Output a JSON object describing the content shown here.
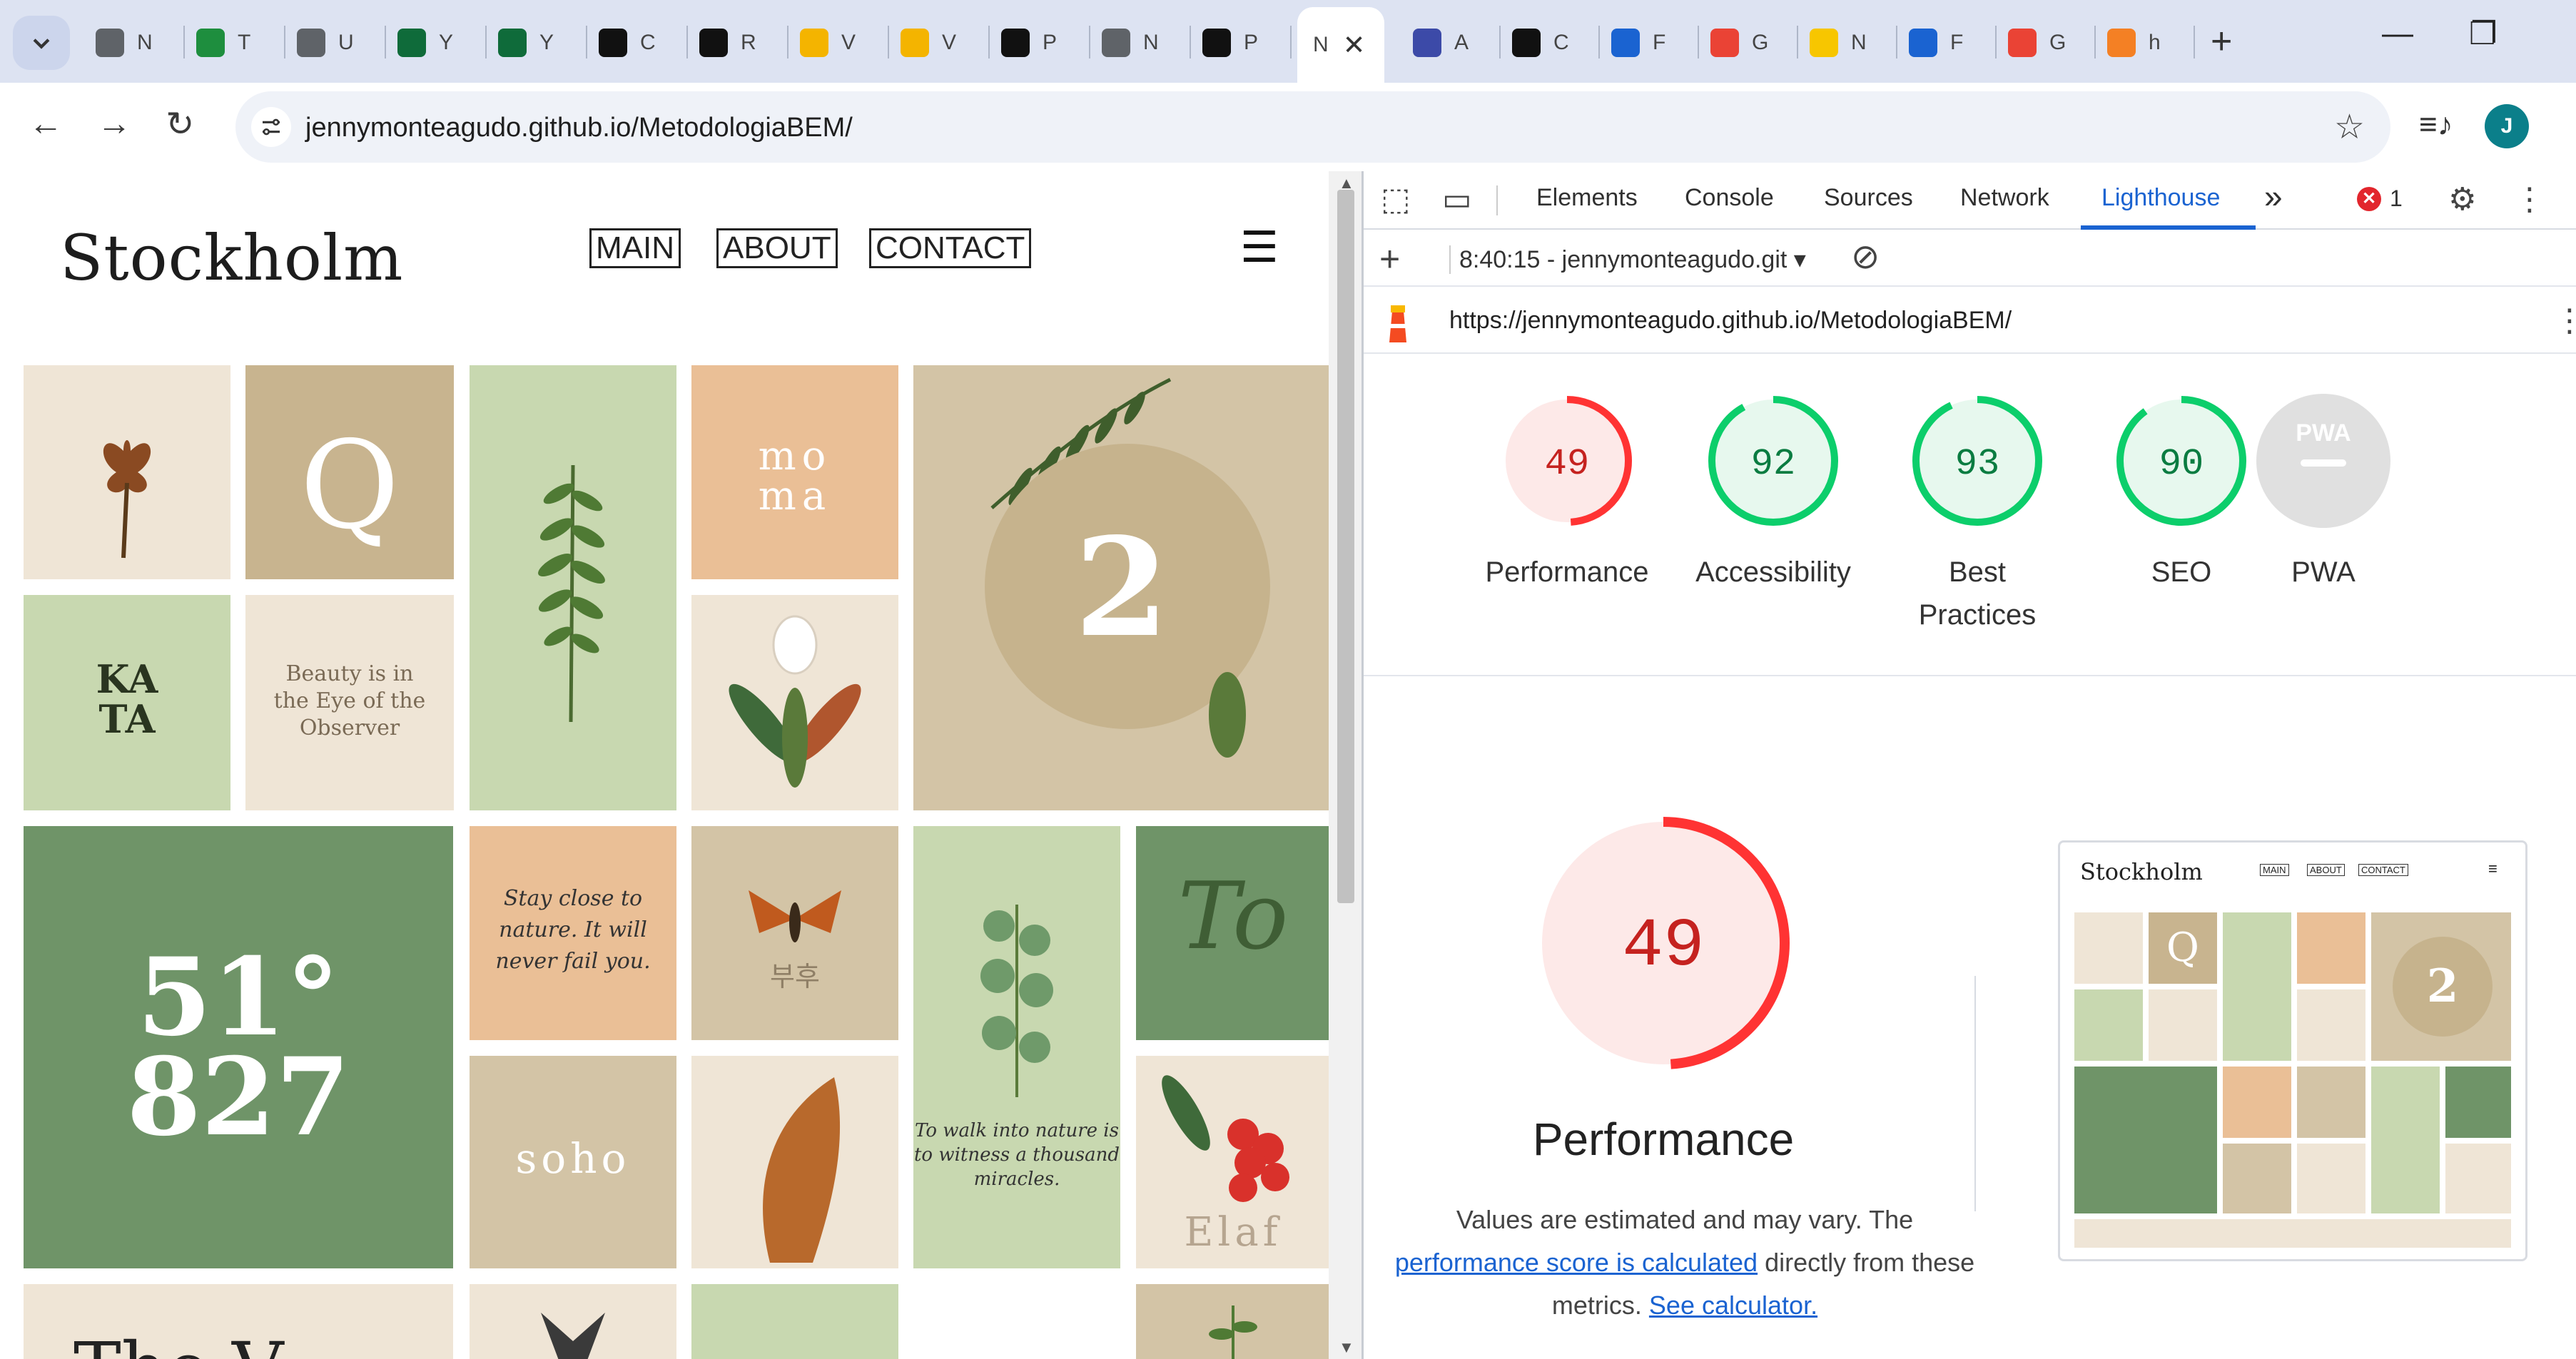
{
  "browser": {
    "tabs": [
      {
        "letter": "N",
        "icon": "globe-icon",
        "color": "#5f6368"
      },
      {
        "letter": "T",
        "icon": "classroom-icon",
        "color": "#1e8e3e"
      },
      {
        "letter": "U",
        "icon": "at-sign-icon",
        "color": "#5f6368"
      },
      {
        "letter": "Y",
        "icon": "flask-icon",
        "color": "#0f6b3a"
      },
      {
        "letter": "Y",
        "icon": "flask-icon",
        "color": "#0f6b3a"
      },
      {
        "letter": "C",
        "icon": "w-icon",
        "color": "#111111"
      },
      {
        "letter": "R",
        "icon": "puzzle-icon",
        "color": "#111111"
      },
      {
        "letter": "V",
        "icon": "drive-icon",
        "color": "#f4b400"
      },
      {
        "letter": "V",
        "icon": "drive-icon",
        "color": "#f4b400"
      },
      {
        "letter": "P",
        "icon": "github-icon",
        "color": "#111111"
      },
      {
        "letter": "N",
        "icon": "globe-icon",
        "color": "#5f6368"
      },
      {
        "letter": "P",
        "icon": "github-icon",
        "color": "#111111"
      }
    ],
    "active_tab": {
      "letter": "N"
    },
    "tabs_right": [
      {
        "letter": "A",
        "icon": "compass-icon",
        "color": "#3c4aa8"
      },
      {
        "letter": "C",
        "icon": "diamond-icon",
        "color": "#111111"
      },
      {
        "letter": "F",
        "icon": "flag-icon",
        "color": "#1a63d1"
      },
      {
        "letter": "G",
        "icon": "google-icon",
        "color": "#ea4335"
      },
      {
        "letter": "N",
        "icon": "mail-icon",
        "color": "#f7c600"
      },
      {
        "letter": "F",
        "icon": "flag-icon",
        "color": "#1a63d1"
      },
      {
        "letter": "G",
        "icon": "google-icon",
        "color": "#ea4335"
      },
      {
        "letter": "h",
        "icon": "stack-icon",
        "color": "#f48024"
      }
    ],
    "url": "jennymonteagudo.github.io/MetodologiaBEM/",
    "profile_initial": "J",
    "newtab_label": "+",
    "window": {
      "minimize": "—",
      "restore": "❐"
    }
  },
  "site": {
    "logo": "Stockholm",
    "nav": [
      "MAIN",
      "ABOUT",
      "CONTACT"
    ],
    "menu_icon": "☰",
    "tiles": {
      "q": "Q",
      "moma": "mo\nma",
      "two": "2",
      "kata": "KA\nTA",
      "beauty": "Beauty is in\nthe Eye of the\nObserver",
      "number": "51°\n827",
      "stay": "Stay close to\nnature. It will\nnever fail you.",
      "moth_text": "부후",
      "walk": "To walk into nature is\nto witness a thousand\nmiracles.",
      "to": "To",
      "soho": "soho",
      "elaf": "Elaf",
      "bottom": "The V"
    }
  },
  "devtools": {
    "tabs": [
      "Elements",
      "Console",
      "Sources",
      "Network",
      "Lighthouse"
    ],
    "active_tab": "Lighthouse",
    "more": "»",
    "error_count": "1",
    "report_time": "8:40:15 - jennymonteagudo.git",
    "report_url": "https://jennymonteagudo.github.io/MetodologiaBEM/",
    "scores": [
      {
        "label": "Performance",
        "value": 49,
        "color": "#f33",
        "bg": "#fde9e8",
        "text": "#c5221f"
      },
      {
        "label": "Accessibility",
        "value": 92,
        "color": "#0cce6b",
        "bg": "#e7f8ee",
        "text": "#0a7c41"
      },
      {
        "label": "Best\nPractices",
        "value": 93,
        "color": "#0cce6b",
        "bg": "#e7f8ee",
        "text": "#0a7c41"
      },
      {
        "label": "SEO",
        "value": 90,
        "color": "#0cce6b",
        "bg": "#e7f8ee",
        "text": "#0a7c41"
      }
    ],
    "pwa": {
      "label": "PWA",
      "badge": "PWA"
    },
    "performance": {
      "value": "49",
      "title": "Performance",
      "desc_1": "Values are estimated and may vary. The",
      "link_1": "performance score is calculated",
      "desc_2": " directly from these",
      "desc_3": "metrics. ",
      "link_2": "See calculator."
    },
    "thumb": {
      "logo": "Stockholm",
      "nav": [
        "MAIN",
        "ABOUT",
        "CONTACT"
      ],
      "two": "2",
      "q": "Q"
    }
  }
}
